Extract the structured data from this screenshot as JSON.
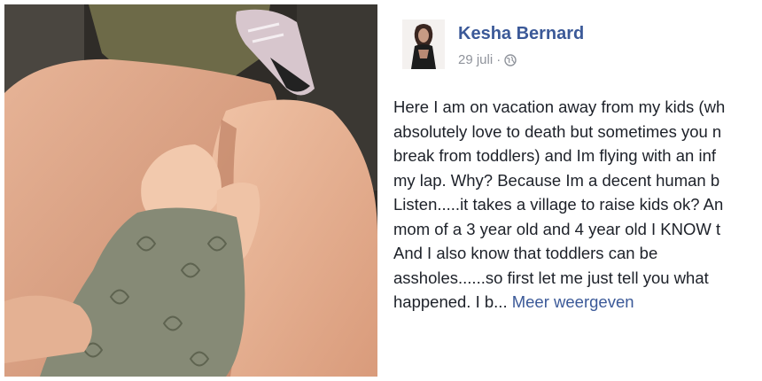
{
  "post": {
    "author": "Kesha Bernard",
    "date": "29 juli",
    "separator": "·",
    "privacy_icon": "globe-icon",
    "lines": [
      "Here I am on vacation away from my kids (wh",
      "absolutely love to death but sometimes you n",
      "break from toddlers) and Im flying with an inf",
      "my lap. Why? Because Im a decent human b",
      "Listen.....it takes a village to raise kids ok? An",
      "mom of a 3 year old and 4 year old I KNOW t",
      "And I also know that toddlers can be",
      "assholes......so first let me just tell you what",
      "happened. I b..."
    ],
    "see_more": "Meer weergeven"
  },
  "colors": {
    "link": "#3b5998",
    "meta": "#90949c",
    "text": "#1d2129"
  }
}
